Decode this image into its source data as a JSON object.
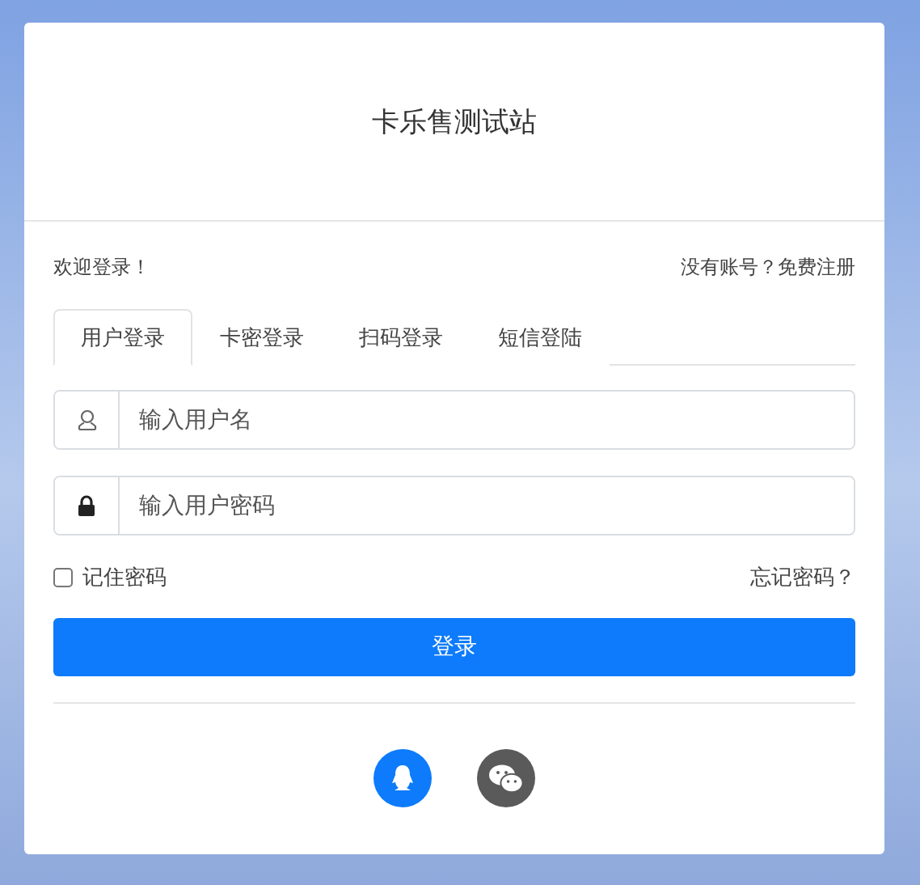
{
  "header": {
    "title": "卡乐售测试站"
  },
  "welcome": "欢迎登录！",
  "register": "没有账号？免费注册",
  "tabs": [
    {
      "label": "用户登录",
      "selected": true
    },
    {
      "label": "卡密登录",
      "selected": false
    },
    {
      "label": "扫码登录",
      "selected": false
    },
    {
      "label": "短信登陆",
      "selected": false
    }
  ],
  "fields": [
    {
      "kind": "user",
      "placeholder": "输入用户名"
    },
    {
      "kind": "password",
      "placeholder": "输入用户密码"
    }
  ],
  "remember": {
    "label": "记住密码",
    "checked": false
  },
  "forgot": "忘记密码？",
  "submit": "登录",
  "social": [
    {
      "kind": "qq",
      "color": "#0d7bfb"
    },
    {
      "kind": "wechat",
      "color": "#5a5a5a"
    }
  ]
}
